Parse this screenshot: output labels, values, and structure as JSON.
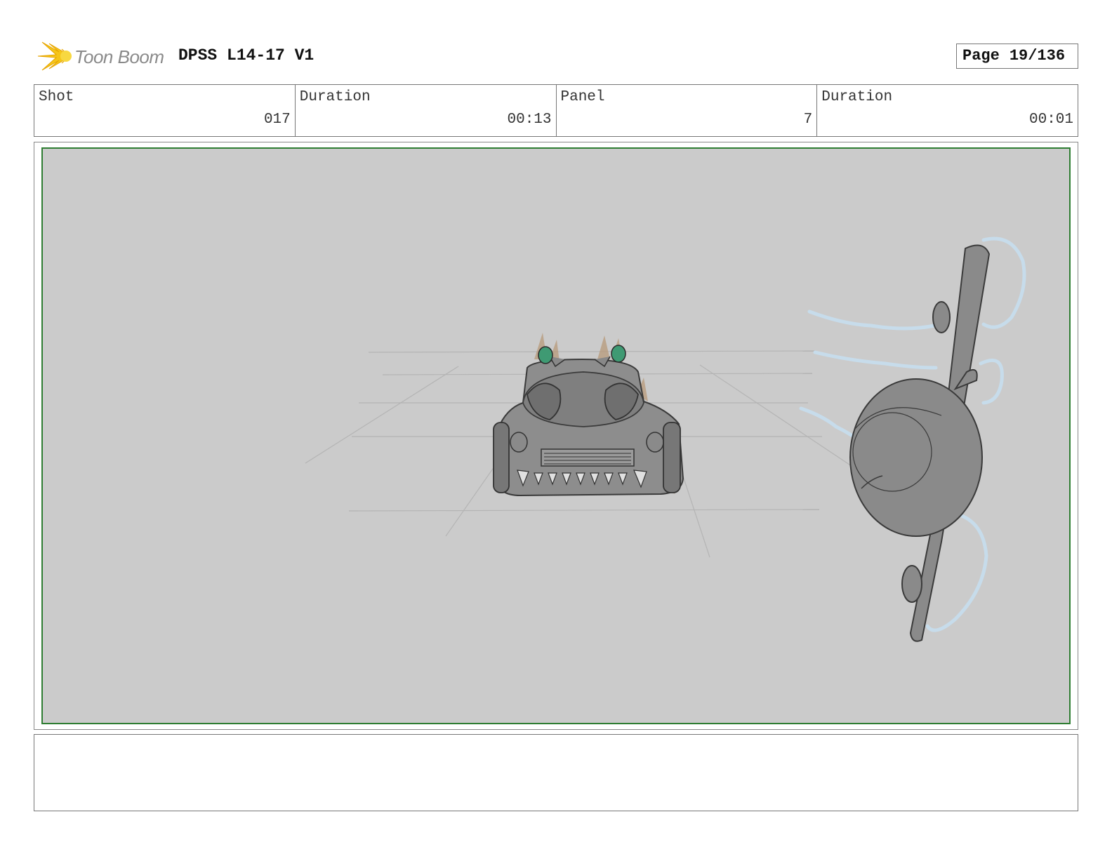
{
  "header": {
    "brand": "Toon Boom",
    "title": "DPSS L14-17 V1",
    "page_label": "Page",
    "page_number": "19/136"
  },
  "info": [
    {
      "label": "Shot",
      "value": "017"
    },
    {
      "label": "Duration",
      "value": "00:13"
    },
    {
      "label": "Panel",
      "value": "7"
    },
    {
      "label": "Duration",
      "value": "00:01"
    }
  ],
  "colors": {
    "panel_frame": "#2e7d32",
    "panel_background": "#cbcbcb",
    "logo_accent": "#f5c518",
    "smoke": "#c7dceb",
    "headlight": "#3f9a73"
  },
  "notes": ""
}
